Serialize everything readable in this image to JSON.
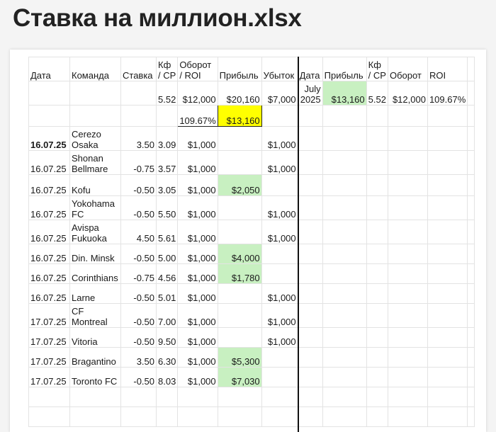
{
  "page": {
    "title": "Ставка на миллион.xlsx"
  },
  "headers": [
    "Дата",
    "Команда",
    "Ставка",
    "Кф / СР",
    "Оборот / ROI",
    "Прибыль",
    "Убыток",
    "Дата",
    "Прибыль",
    "Кф / СР",
    "Оборот",
    "ROI"
  ],
  "summary": {
    "kf": "5.52",
    "turnover": "$12,000",
    "profit": "$20,160",
    "loss": "$7,000",
    "roi": "109.67%",
    "net": "$13,160"
  },
  "month": {
    "date": "July 2025",
    "profit": "$13,160",
    "kf": "5.52",
    "turnover": "$12,000",
    "roi": "109.67%"
  },
  "rows": [
    {
      "date": "16.07.25",
      "team": "Cerezo Osaka",
      "stake": "3.50",
      "kf": "3.09",
      "turnover": "$1,000",
      "profit": "",
      "loss": "$1,000"
    },
    {
      "date": "16.07.25",
      "team": "Shonan Bellmare",
      "stake": "-0.75",
      "kf": "3.57",
      "turnover": "$1,000",
      "profit": "",
      "loss": "$1,000"
    },
    {
      "date": "16.07.25",
      "team": "Kofu",
      "stake": "-0.50",
      "kf": "3.05",
      "turnover": "$1,000",
      "profit": "$2,050",
      "loss": ""
    },
    {
      "date": "16.07.25",
      "team": "Yokohama FC",
      "stake": "-0.50",
      "kf": "5.50",
      "turnover": "$1,000",
      "profit": "",
      "loss": "$1,000"
    },
    {
      "date": "16.07.25",
      "team": "Avispa Fukuoka",
      "stake": "4.50",
      "kf": "5.61",
      "turnover": "$1,000",
      "profit": "",
      "loss": "$1,000"
    },
    {
      "date": "16.07.25",
      "team": "Din. Minsk",
      "stake": "-0.50",
      "kf": "5.00",
      "turnover": "$1,000",
      "profit": "$4,000",
      "loss": ""
    },
    {
      "date": "16.07.25",
      "team": "Corinthians",
      "stake": "-0.75",
      "kf": "4.56",
      "turnover": "$1,000",
      "profit": "$1,780",
      "loss": ""
    },
    {
      "date": "16.07.25",
      "team": "Larne",
      "stake": "-0.50",
      "kf": "5.01",
      "turnover": "$1,000",
      "profit": "",
      "loss": "$1,000"
    },
    {
      "date": "17.07.25",
      "team": "CF Montreal",
      "stake": "-0.50",
      "kf": "7.00",
      "turnover": "$1,000",
      "profit": "",
      "loss": "$1,000"
    },
    {
      "date": "17.07.25",
      "team": "Vitoria",
      "stake": "-0.50",
      "kf": "9.50",
      "turnover": "$1,000",
      "profit": "",
      "loss": "$1,000"
    },
    {
      "date": "17.07.25",
      "team": "Bragantino",
      "stake": "3.50",
      "kf": "6.30",
      "turnover": "$1,000",
      "profit": "$5,300",
      "loss": ""
    },
    {
      "date": "17.07.25",
      "team": "Toronto FC",
      "stake": "-0.50",
      "kf": "8.03",
      "turnover": "$1,000",
      "profit": "$7,030",
      "loss": ""
    }
  ]
}
